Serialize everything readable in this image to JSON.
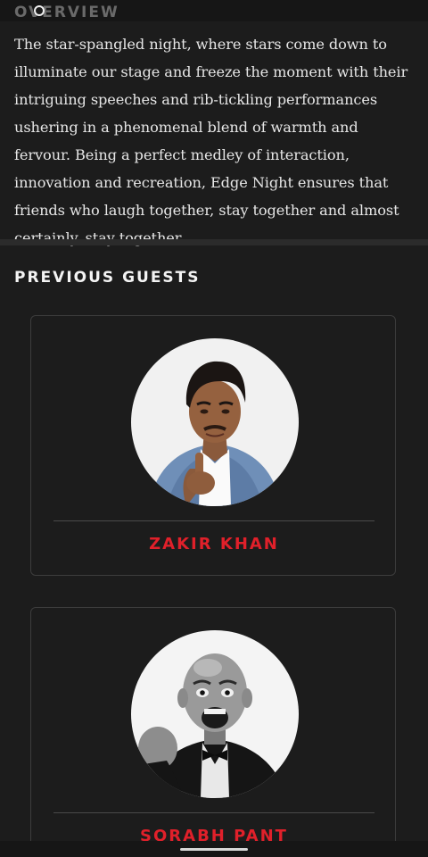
{
  "overview": {
    "title": "OVERVIEW",
    "text": "The star-spangled night, where stars come down to illuminate our stage and freeze the moment with their intriguing speeches and rib-tickling performances ushering in a phenomenal blend of warmth and fervour. Being a perfect medley of interaction, innovation and recreation, Edge Night ensures that friends who laugh together, stay together and almost certainly, stay together."
  },
  "previous_guests": {
    "title": "PREVIOUS GUESTS",
    "guests": [
      {
        "name": "ZAKIR KHAN"
      },
      {
        "name": "SORABH PANT"
      }
    ]
  },
  "colors": {
    "background": "#1c1c1c",
    "accent": "#e0202a",
    "text": "#e6e6e6",
    "muted": "#6a6a6a"
  }
}
